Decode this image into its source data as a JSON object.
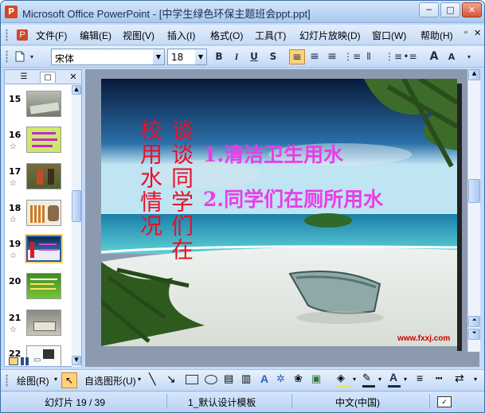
{
  "window": {
    "title": "Microsoft Office PowerPoint - [中学生绿色环保主题班会ppt.ppt]",
    "minimize": "─",
    "restore": "□",
    "close": "✕"
  },
  "menu": {
    "items": [
      "文件(F)",
      "编辑(E)",
      "视图(V)",
      "插入(I)",
      "格式(O)",
      "工具(T)",
      "幻灯片放映(D)",
      "窗口(W)",
      "帮助(H)"
    ],
    "doc_restore": "▫",
    "doc_close": "✕"
  },
  "toolbar": {
    "font_name": "宋体",
    "font_size": "18",
    "bold": "B",
    "italic": "I",
    "underline": "U",
    "shadow": "S",
    "align_left": "≡",
    "align_center": "≡",
    "align_right": "≡",
    "grow": "A",
    "shrink": "A"
  },
  "slide_pane": {
    "tab_outline": "☰",
    "tab_slides": "▢",
    "close": "✕",
    "thumbnails": [
      {
        "num": "15",
        "star": ""
      },
      {
        "num": "16",
        "star": "☆"
      },
      {
        "num": "17",
        "star": "☆"
      },
      {
        "num": "18",
        "star": "☆"
      },
      {
        "num": "19",
        "star": "☆"
      },
      {
        "num": "20",
        "star": ""
      },
      {
        "num": "21",
        "star": "☆"
      },
      {
        "num": "22",
        "star": ""
      }
    ]
  },
  "slide": {
    "left_col1": "校用水情况",
    "left_col2": "谈谈同学们在",
    "point1": "1.清洁卫生用水",
    "point2": "2.同学们在厕所用水",
    "watermark": "www.fxxj.com",
    "colors": {
      "vertical_text": "#e8102a",
      "points": "#e83ee8"
    }
  },
  "drawbar": {
    "draw": "绘图(R)",
    "autoshapes": "自选图形(U)"
  },
  "status": {
    "slide_info": "幻灯片 19 / 39",
    "template": "1_默认设计模板",
    "language": "中文(中国)"
  }
}
